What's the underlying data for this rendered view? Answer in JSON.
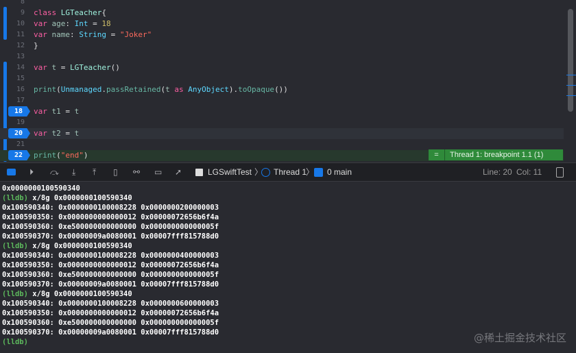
{
  "editor": {
    "lines": [
      {
        "n": "8",
        "tokens": []
      },
      {
        "n": "9",
        "tokens": [
          [
            "kw",
            "class "
          ],
          [
            "cls",
            "LGTeacher"
          ],
          [
            "pl",
            "{"
          ]
        ]
      },
      {
        "n": "10",
        "tokens": [
          [
            "kw",
            "var "
          ],
          [
            "var",
            "age"
          ],
          [
            "pl",
            ": "
          ],
          [
            "ty",
            "Int"
          ],
          [
            "pl",
            " = "
          ],
          [
            "num",
            "18"
          ]
        ]
      },
      {
        "n": "11",
        "tokens": [
          [
            "kw",
            "var "
          ],
          [
            "var",
            "name"
          ],
          [
            "pl",
            ": "
          ],
          [
            "ty",
            "String"
          ],
          [
            "pl",
            " = "
          ],
          [
            "str",
            "\"Joker\""
          ]
        ]
      },
      {
        "n": "12",
        "tokens": [
          [
            "pl",
            "}"
          ]
        ]
      },
      {
        "n": "13",
        "tokens": []
      },
      {
        "n": "14",
        "tokens": [
          [
            "kw",
            "var "
          ],
          [
            "var",
            "t"
          ],
          [
            "pl",
            " = "
          ],
          [
            "cls",
            "LGTeacher"
          ],
          [
            "pl",
            "()"
          ]
        ]
      },
      {
        "n": "15",
        "tokens": []
      },
      {
        "n": "16",
        "tokens": [
          [
            "fn",
            "print"
          ],
          [
            "pl",
            "("
          ],
          [
            "ty",
            "Unmanaged"
          ],
          [
            "pl",
            "."
          ],
          [
            "fn",
            "passRetained"
          ],
          [
            "pl",
            "("
          ],
          [
            "var",
            "t"
          ],
          [
            "kw",
            " as "
          ],
          [
            "ty",
            "AnyObject"
          ],
          [
            "pl",
            ")."
          ],
          [
            "fn",
            "toOpaque"
          ],
          [
            "pl",
            "())"
          ]
        ]
      },
      {
        "n": "17",
        "tokens": []
      },
      {
        "n": "18",
        "tokens": [
          [
            "kw",
            "var "
          ],
          [
            "var",
            "t1"
          ],
          [
            "pl",
            " = "
          ],
          [
            "var",
            "t"
          ]
        ],
        "breakpoint": true
      },
      {
        "n": "19",
        "tokens": []
      },
      {
        "n": "20",
        "tokens": [
          [
            "kw",
            "var "
          ],
          [
            "var",
            "t2"
          ],
          [
            "pl",
            " = "
          ],
          [
            "var",
            "t"
          ]
        ],
        "breakpoint": true,
        "current": true
      },
      {
        "n": "21",
        "tokens": []
      },
      {
        "n": "22",
        "tokens": [
          [
            "fn",
            "print"
          ],
          [
            "pl",
            "("
          ],
          [
            "str",
            "\"end\""
          ],
          [
            "pl",
            ")"
          ]
        ],
        "breakpoint": true,
        "stopped": true
      }
    ],
    "banner": "Thread 1: breakpoint 1.1 (1)",
    "banner_icon": "equals-icon"
  },
  "toolbar": {
    "target": "LGSwiftTest",
    "thread": "Thread 1",
    "frame": "0 main",
    "line": "Line: 20",
    "col": "Col: 11"
  },
  "console": {
    "lines": [
      "0x0000000100590340",
      "(lldb) |x/8g 0x0000000100590340",
      "0x100590340: 0x0000000100008228 0x0000000200000003",
      "0x100590350: 0x0000000000000012 0x00000072656b6f4a",
      "0x100590360: 0xe500000000000000 0x000000000000005f",
      "0x100590370: 0x00000009a0080001 0x00007fff815788d0",
      "(lldb) |x/8g 0x0000000100590340",
      "0x100590340: 0x0000000100008228 0x0000000400000003",
      "0x100590350: 0x0000000000000012 0x00000072656b6f4a",
      "0x100590360: 0xe500000000000000 0x000000000000005f",
      "0x100590370: 0x00000009a0080001 0x00007fff815788d0",
      "(lldb) |x/8g 0x0000000100590340",
      "0x100590340: 0x0000000100008228 0x0000000600000003",
      "0x100590350: 0x0000000000000012 0x00000072656b6f4a",
      "0x100590360: 0xe500000000000000 0x000000000000005f",
      "0x100590370: 0x00000009a0080001 0x00007fff815788d0",
      "(lldb) |"
    ]
  },
  "watermark": "@稀土掘金技术社区"
}
